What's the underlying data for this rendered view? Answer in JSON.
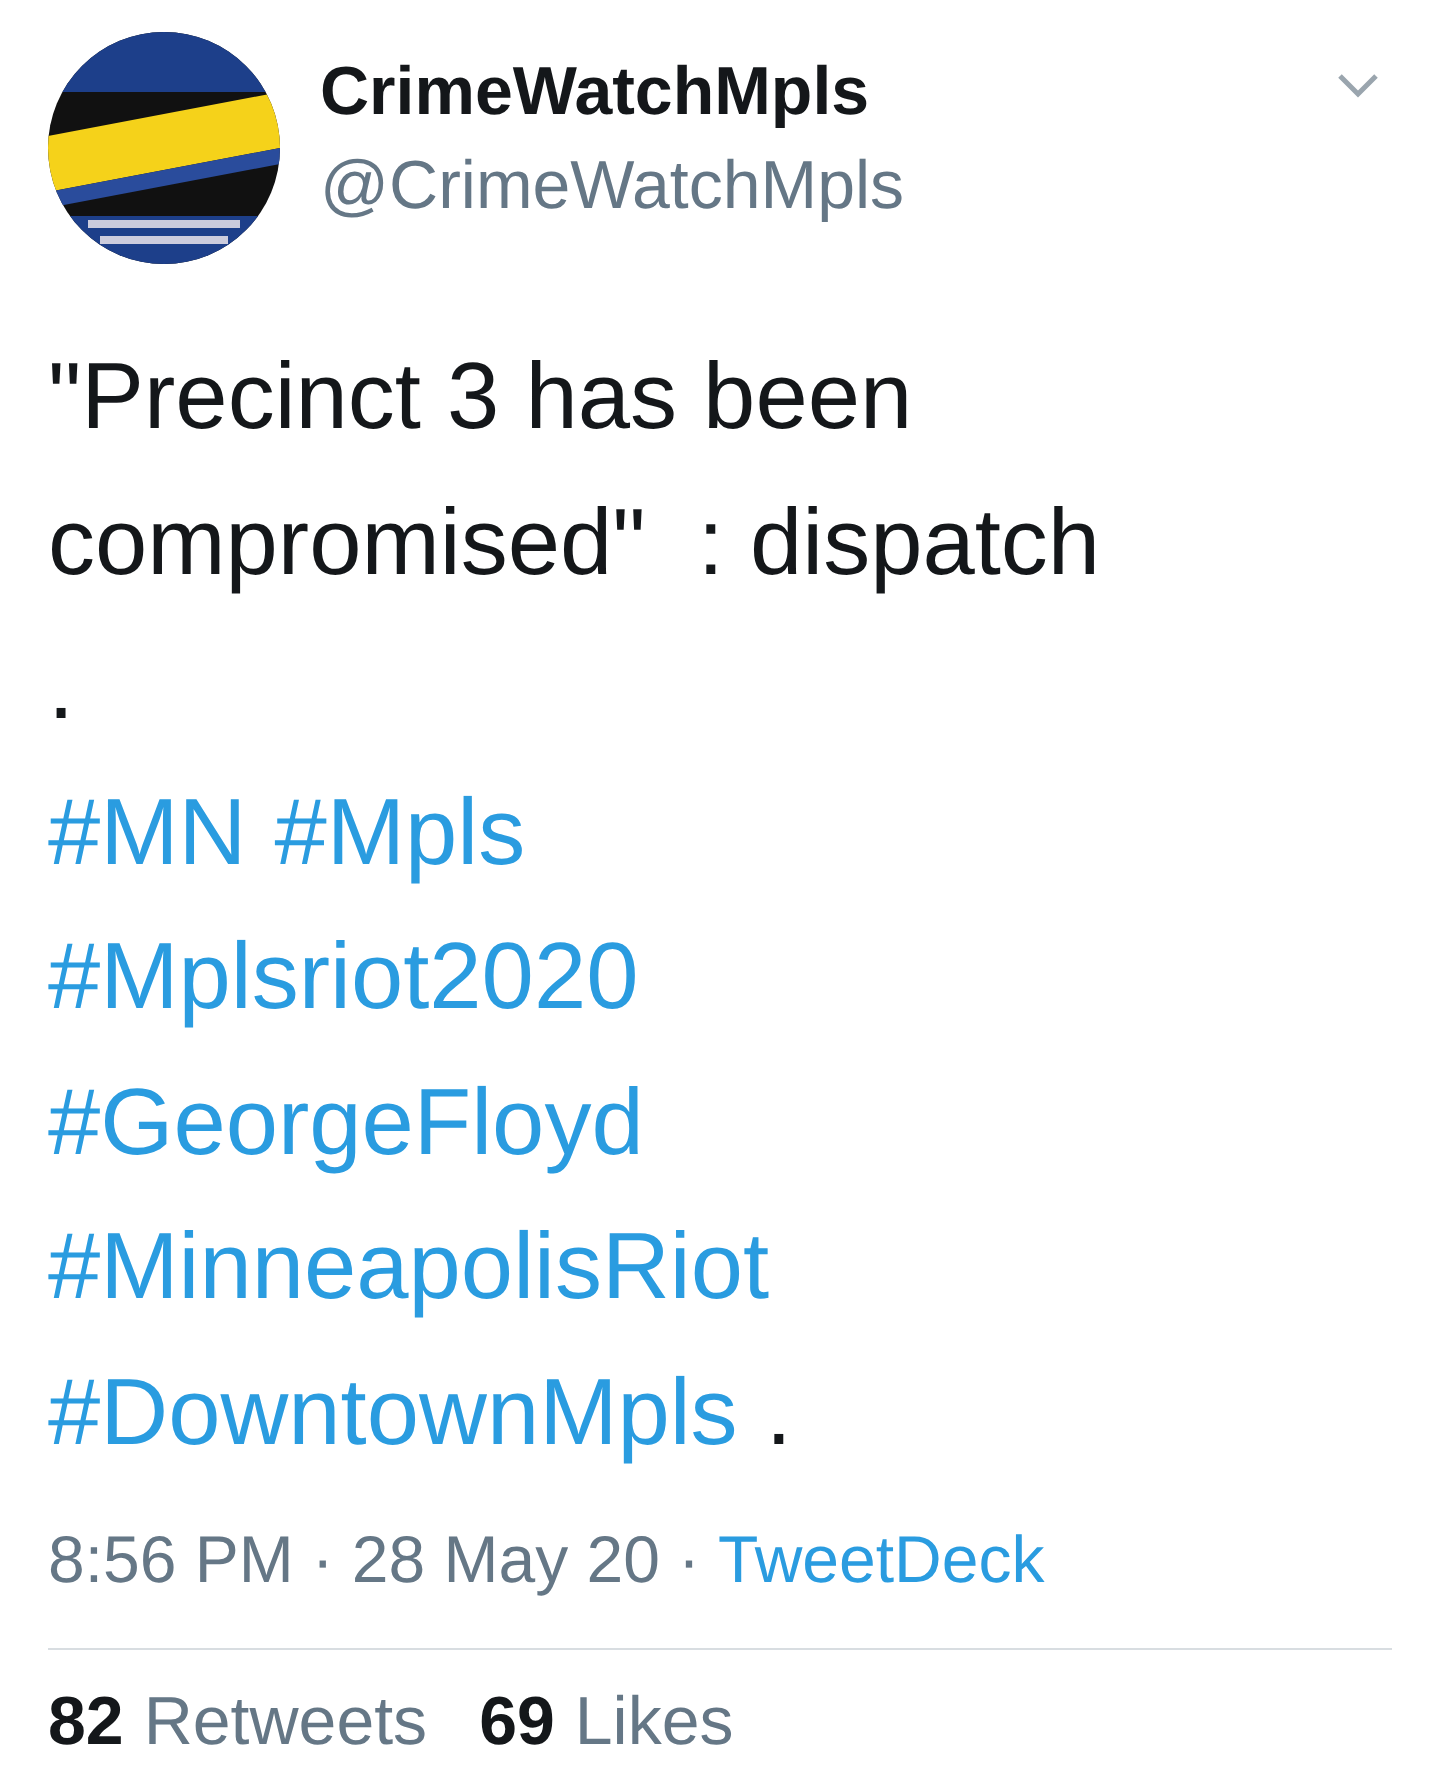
{
  "author": {
    "name": "CrimeWatchMpls",
    "handle": "@CrimeWatchMpls"
  },
  "tweet": {
    "lines": [
      [
        {
          "kind": "text",
          "text": "\"Precinct 3 has been"
        }
      ],
      [
        {
          "kind": "text",
          "text": "compromised\"  : dispatch"
        }
      ],
      [
        {
          "kind": "text",
          "text": "."
        }
      ],
      [
        {
          "kind": "hashtag",
          "text": "#MN"
        },
        {
          "kind": "hashtag",
          "text": "#Mpls"
        }
      ],
      [
        {
          "kind": "hashtag",
          "text": "#Mplsriot2020"
        }
      ],
      [
        {
          "kind": "hashtag",
          "text": "#GeorgeFloyd"
        }
      ],
      [
        {
          "kind": "hashtag",
          "text": "#MinneapolisRiot"
        }
      ],
      [
        {
          "kind": "hashtag",
          "text": "#DowntownMpls"
        },
        {
          "kind": "text",
          "text": "."
        }
      ]
    ]
  },
  "meta": [
    {
      "kind": "text",
      "text": "8:56 PM"
    },
    {
      "kind": "separator",
      "text": "·"
    },
    {
      "kind": "text",
      "text": "28 May 20"
    },
    {
      "kind": "separator",
      "text": "·"
    },
    {
      "kind": "link",
      "text": "TweetDeck"
    }
  ],
  "stats": [
    {
      "count": "82",
      "label": "Retweets"
    },
    {
      "count": "69",
      "label": "Likes"
    }
  ]
}
